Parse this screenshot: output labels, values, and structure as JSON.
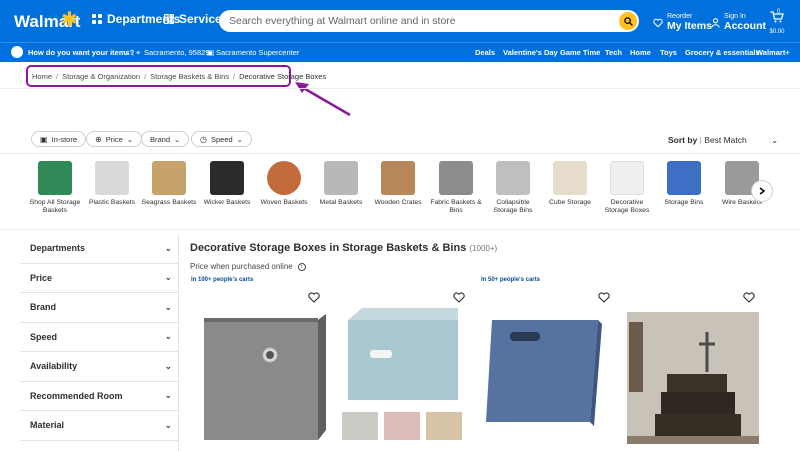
{
  "header": {
    "logo": "Walmart",
    "departments_label": "Departments",
    "services_label": "Services",
    "search_placeholder": "Search everything at Walmart online and in store",
    "reorder_top": "Reorder",
    "reorder_bottom": "My Items",
    "signin_top": "Sign In",
    "signin_bottom": "Account",
    "cart_count": "0",
    "cart_price": "$0.00"
  },
  "subheader": {
    "delivery_prompt": "How do you want your items?",
    "location": "Sacramento, 95829",
    "store": "Sacramento Supercenter",
    "links": [
      "Deals",
      "Valentine's Day",
      "Game Time",
      "Tech",
      "Home",
      "Toys",
      "Grocery & essentials",
      "Walmart+"
    ]
  },
  "breadcrumb": [
    "Home",
    "Storage & Organization",
    "Storage Baskets & Bins",
    "Decorative Storage Boxes"
  ],
  "filters": {
    "pills": [
      "In-store",
      "Price",
      "Brand",
      "Speed"
    ],
    "sort_label": "Sort by",
    "sort_value": "Best Match"
  },
  "categories": [
    {
      "label": "Shop All Storage Baskets",
      "color": "#2f8a57"
    },
    {
      "label": "Plastic Baskets",
      "color": "#d9d9d9"
    },
    {
      "label": "Seagrass Baskets",
      "color": "#c8a26b"
    },
    {
      "label": "Wicker Baskets",
      "color": "#2b2b2b"
    },
    {
      "label": "Woven Baskets",
      "color": "#c46b3c"
    },
    {
      "label": "Metal Baskets",
      "color": "#b8b8b8"
    },
    {
      "label": "Wooden Crates",
      "color": "#b9885a"
    },
    {
      "label": "Fabric Baskets & Bins",
      "color": "#8c8c8c"
    },
    {
      "label": "Collapsible Storage Bins",
      "color": "#bfbfbf"
    },
    {
      "label": "Cube Storage",
      "color": "#e6dccb"
    },
    {
      "label": "Decorative Storage Boxes",
      "color": "#efefef"
    },
    {
      "label": "Storage Bins",
      "color": "#3d6fc4"
    },
    {
      "label": "Wire Baskets",
      "color": "#9a9a9a"
    }
  ],
  "sidebar": [
    "Departments",
    "Price",
    "Brand",
    "Speed",
    "Availability",
    "Recommended Room",
    "Material"
  ],
  "results": {
    "title": "Decorative Storage Boxes in Storage Baskets & Bins",
    "count": "(1000+)",
    "price_note": "Price when purchased online",
    "tags": [
      "In 100+ people's carts",
      "In 50+ people's carts"
    ]
  },
  "colors": {
    "brand_blue": "#0071dc",
    "spark_yellow": "#ffc220",
    "annotation_purple": "#8b1a9a"
  }
}
